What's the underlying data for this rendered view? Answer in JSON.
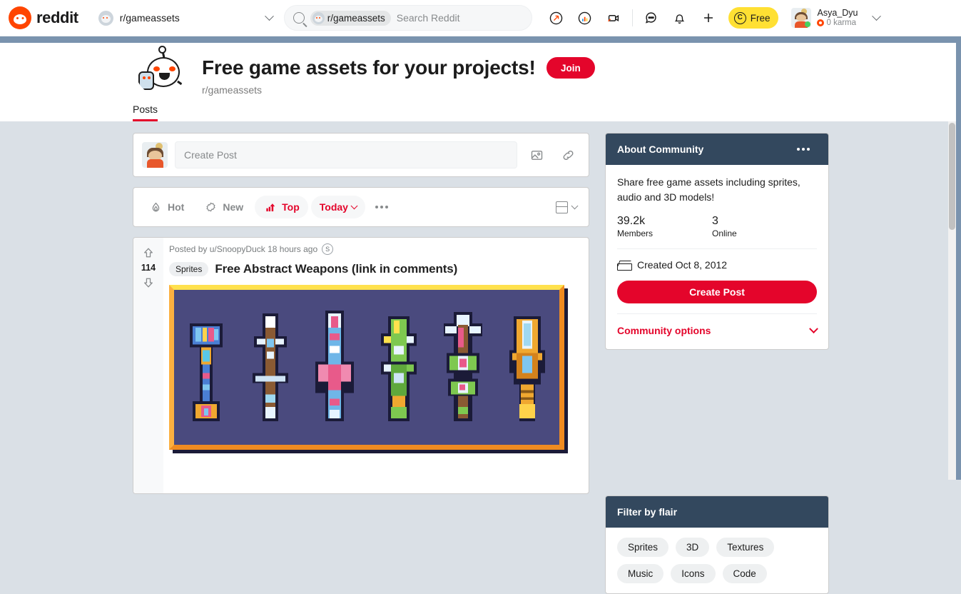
{
  "topnav": {
    "logo_text": "reddit",
    "logo_icon": "reddit-logo-icon",
    "subreddit_selector": "r/gameassets",
    "search": {
      "chip_label": "r/gameassets",
      "placeholder": "Search Reddit",
      "icon": "search-icon"
    },
    "icons": [
      "popular-arrow-icon",
      "trending-chart-icon",
      "video-broadcast-icon",
      "chat-icon",
      "notification-bell-icon",
      "create-plus-icon"
    ],
    "free_pill": {
      "label": "Free",
      "coin_glyph": "C"
    },
    "user": {
      "name": "Asya_Dyu",
      "karma": "0 karma"
    }
  },
  "community": {
    "title": "Free game assets for your projects!",
    "subtitle": "r/gameassets",
    "join_label": "Join",
    "tabs": [
      {
        "label": "Posts",
        "active": true
      }
    ]
  },
  "create_post": {
    "placeholder": "Create Post",
    "image_icon": "image-icon",
    "link_icon": "link-icon"
  },
  "sortbar": {
    "items": [
      {
        "label": "Hot",
        "icon": "flame-icon",
        "active": false
      },
      {
        "label": "New",
        "icon": "sparkle-icon",
        "active": false
      },
      {
        "label": "Top",
        "icon": "trending-up-icon",
        "active": true
      }
    ],
    "time_filter": "Today",
    "more_label": "more-options",
    "view_label": "card-view"
  },
  "post": {
    "vote_count": "114",
    "meta": "Posted by u/SnoopyDuck 18 hours ago",
    "award_glyph": "S",
    "flair": "Sprites",
    "title": "Free Abstract Weapons (link in comments)",
    "image_alt": "pixel-art-weapons-sprite-sheet"
  },
  "sidebar": {
    "about": {
      "heading": "About Community",
      "description": "Share free game assets including sprites, audio and 3D models!",
      "stats": [
        {
          "value": "39.2k",
          "label": "Members"
        },
        {
          "value": "3",
          "label": "Online"
        }
      ],
      "created": "Created Oct 8, 2012",
      "create_post_label": "Create Post",
      "community_options_label": "Community options"
    },
    "flair": {
      "heading": "Filter by flair",
      "chips": [
        "Sprites",
        "3D",
        "Textures",
        "Music",
        "Icons",
        "Code"
      ]
    }
  },
  "colors": {
    "brand_orange": "#ff4500",
    "accent_red": "#e4052b",
    "sidebar_header": "#33485e",
    "page_bg": "#dae0e6",
    "banner_blue": "#7a93ae",
    "free_yellow": "#ffe033",
    "art_bg": "#4a4a7e",
    "art_border": "#ef8b21"
  }
}
